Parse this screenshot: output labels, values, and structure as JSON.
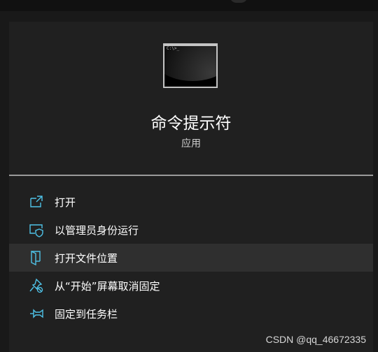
{
  "app": {
    "name": "命令提示符",
    "type": "应用",
    "icon": "command-prompt-icon",
    "icon_text": "C:\\>_"
  },
  "menu": {
    "items": [
      {
        "label": "打开",
        "icon": "open-icon"
      },
      {
        "label": "以管理员身份运行",
        "icon": "run-as-admin-icon"
      },
      {
        "label": "打开文件位置",
        "icon": "open-file-location-icon"
      },
      {
        "label": "从“开始”屏幕取消固定",
        "icon": "unpin-from-start-icon"
      },
      {
        "label": "固定到任务栏",
        "icon": "pin-to-taskbar-icon"
      }
    ],
    "highlighted_index": 2
  },
  "watermark": "CSDN @qq_46672335",
  "colors": {
    "background": "#191919",
    "panel": "#202020",
    "highlight": "#2f2f2f",
    "icon_accent": "#4fc3e8"
  }
}
